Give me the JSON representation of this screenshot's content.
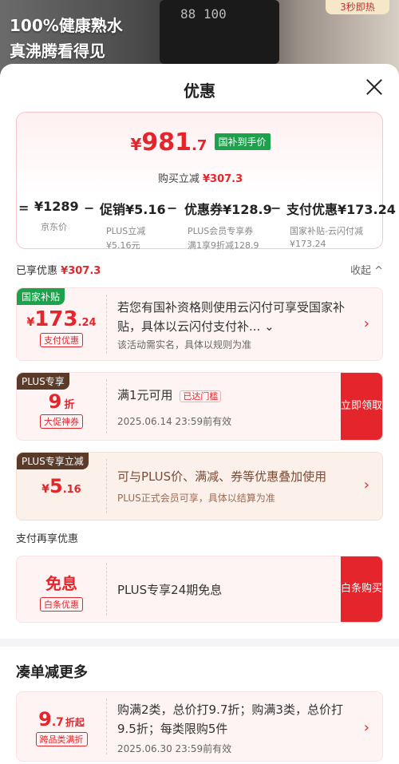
{
  "background": {
    "promo_line1": "100%健康熟水",
    "promo_line2": "真沸腾看得见",
    "display_digits": "88  100",
    "corner_tag": "3秒即热"
  },
  "sheet": {
    "title": "优惠",
    "close_icon": "close-icon"
  },
  "price_card": {
    "currency": "¥",
    "price_int": "981",
    "price_dec": ".7",
    "badge": "国补到手价",
    "reduce_label": "购买立减",
    "reduce_amount": "¥307.3",
    "calc": {
      "eq": "=",
      "minus": "−",
      "items": [
        {
          "value": "¥1289",
          "label": "京东价",
          "label2": ""
        },
        {
          "value": "促销¥5.16",
          "label": "PLUS立减",
          "label2": "¥5.16元"
        },
        {
          "value": "优惠券¥128.9",
          "label": "PLUS会员专享券",
          "label2": "满1享9折减128.9"
        },
        {
          "value": "支付优惠¥173.24",
          "label": "国家补贴-云闪付减",
          "label2": "¥173.24"
        }
      ]
    }
  },
  "enjoyed": {
    "label": "已享优惠",
    "amount": "¥307.3",
    "collapse_label": "收起 ^"
  },
  "coupons": [
    {
      "tag": "国家补贴",
      "tag_color": "#1aa34a",
      "currency": "¥",
      "amount_int": "173",
      "amount_dec": ".24",
      "sub": "支付优惠",
      "desc": "若您有国补资格则使用云闪付可享受国家补贴，具体以云闪付支付补... ⌄",
      "note": "该活动需实名，具体以规则为准",
      "arrow": "›"
    },
    {
      "tag": "PLUS专享",
      "tag_color": "#5a3b2a",
      "amount_int": "9",
      "amount_unit": "折",
      "sub": "大促神券",
      "desc": "满1元可用",
      "desc_badge": "已达门槛",
      "note": "2025.06.14 23:59前有效",
      "button": "立即领取"
    },
    {
      "tag": "PLUS专享立减",
      "tag_color": "#5a3b2a",
      "currency": "¥",
      "amount_int": "5",
      "amount_dec": ".16",
      "desc": "可与PLUS价、满减、券等优惠叠加使用",
      "note": "PLUS正式会员可享，具体以结算为准",
      "arrow": "›"
    }
  ],
  "pay_section": {
    "label": "支付再享优惠",
    "coupon": {
      "title": "免息",
      "sub": "白条优惠",
      "desc": "PLUS专享24期免息",
      "button": "白条购买"
    }
  },
  "more_section": {
    "title": "凑单减更多",
    "coupon": {
      "amount_int": "9",
      "amount_dec": ".7",
      "amount_unit": "折起",
      "sub": "跨品类满折",
      "desc": "购满2类，总价打9.7折；购满3类，总价打9.5折；每类限购5件",
      "note": "2025.06.30 23:59前有效",
      "arrow": "›"
    }
  },
  "colors": {
    "accent_red": "#e4262c",
    "green_badge": "#1aa34a",
    "plus_brown": "#5a3b2a"
  }
}
